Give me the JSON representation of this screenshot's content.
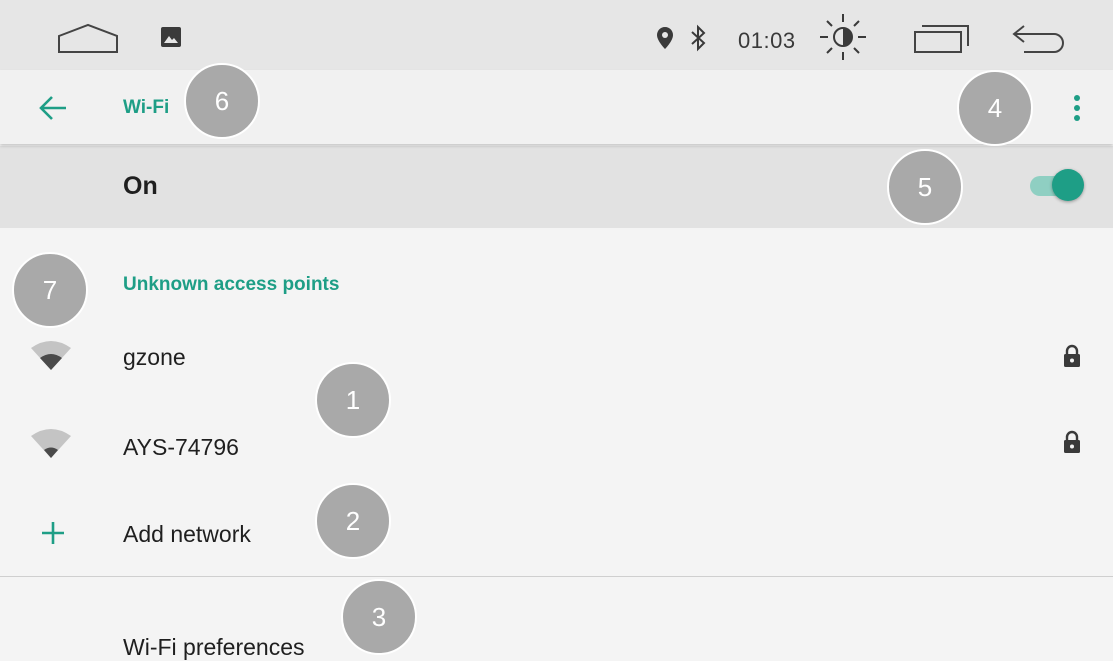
{
  "status_bar": {
    "time": "01:03",
    "icons": [
      "home-icon",
      "gallery-icon",
      "location-icon",
      "bluetooth-icon",
      "brightness-icon",
      "recent-apps-icon",
      "back-icon"
    ]
  },
  "toolbar": {
    "title": "Wi-Fi",
    "back_icon": "arrow-left-icon",
    "menu_icon": "more-vert-icon"
  },
  "master_switch": {
    "label": "On",
    "checked": true
  },
  "category": {
    "title": "Unknown access points"
  },
  "networks": [
    {
      "ssid": "gzone",
      "secured": true,
      "signal_icon": "wifi-signal-icon"
    },
    {
      "ssid": "AYS-74796",
      "secured": true,
      "signal_icon": "wifi-signal-icon"
    }
  ],
  "add_network": {
    "label": "Add network",
    "icon": "plus-icon"
  },
  "preferences": {
    "label": "Wi-Fi preferences"
  },
  "callouts": [
    "1",
    "2",
    "3",
    "4",
    "5",
    "6",
    "7"
  ],
  "colors": {
    "accent": "#1e9e86",
    "callout": "#a9a9a9"
  }
}
